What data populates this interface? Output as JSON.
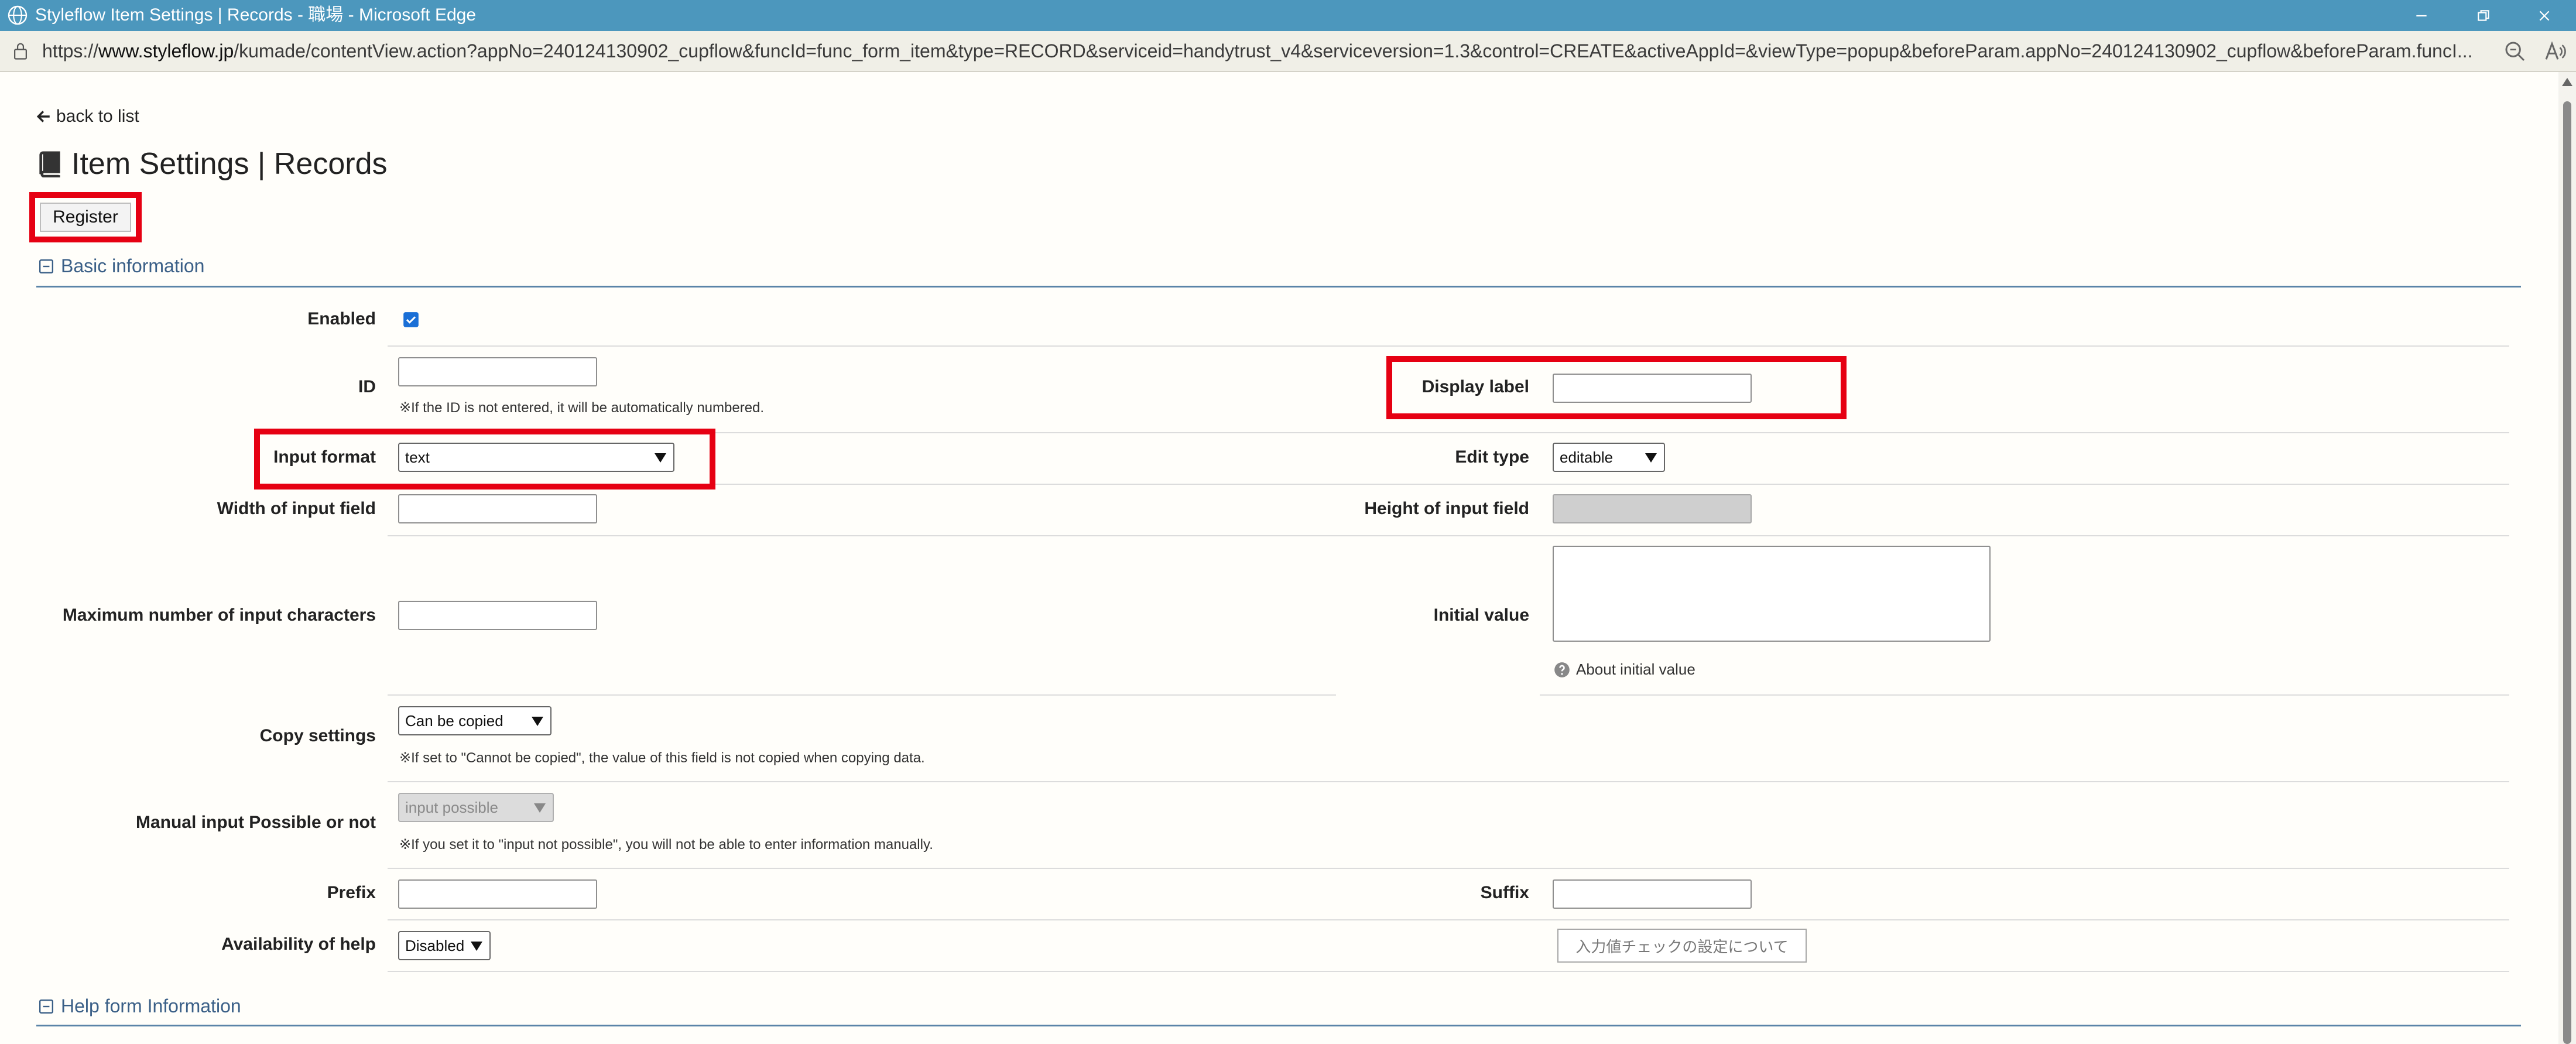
{
  "window": {
    "title": "Styleflow Item Settings | Records - 職場 - Microsoft Edge"
  },
  "address": {
    "url_prefix": "https://",
    "url_host": "www.styleflow.jp",
    "url_rest": "/kumade/contentView.action?appNo=240124130902_cupflow&funcId=func_form_item&type=RECORD&serviceid=handytrust_v4&serviceversion=1.3&control=CREATE&activeAppId=&viewType=popup&beforeParam.appNo=240124130902_cupflow&beforeParam.funcI..."
  },
  "nav": {
    "back_label": "back to list"
  },
  "page": {
    "title": "Item Settings | Records"
  },
  "toolbar": {
    "register_label": "Register"
  },
  "sections": {
    "basic": "Basic information",
    "help": "Help form Information"
  },
  "form": {
    "enabled": {
      "label": "Enabled",
      "checked": true
    },
    "id": {
      "label": "ID",
      "value": "",
      "note": "※If the ID is not entered, it will be automatically numbered."
    },
    "display_label": {
      "label": "Display label",
      "value": ""
    },
    "input_format": {
      "label": "Input format",
      "value": "text"
    },
    "edit_type": {
      "label": "Edit type",
      "value": "editable"
    },
    "width": {
      "label": "Width of input field",
      "value": ""
    },
    "height": {
      "label": "Height of input field",
      "value": ""
    },
    "max_chars": {
      "label": "Maximum number of input characters",
      "value": ""
    },
    "initial_value": {
      "label": "Initial value",
      "value": "",
      "help_link": "About initial value"
    },
    "copy_settings": {
      "label": "Copy settings",
      "value": "Can be copied",
      "note": "※If set to \"Cannot be copied\", the value of this field is not copied when copying data."
    },
    "manual_input": {
      "label": "Manual input Possible or not",
      "value": "input possible",
      "note": "※If you set it to \"input not possible\", you will not be able to enter information manually."
    },
    "prefix": {
      "label": "Prefix",
      "value": ""
    },
    "suffix": {
      "label": "Suffix",
      "value": ""
    },
    "help_availability": {
      "label": "Availability of help",
      "value": "Disabled"
    },
    "check_settings_button": "入力値チェックの設定について"
  },
  "colors": {
    "titlebar": "#4c97bd",
    "highlight": "#e60012",
    "section": "#3a5f87"
  }
}
